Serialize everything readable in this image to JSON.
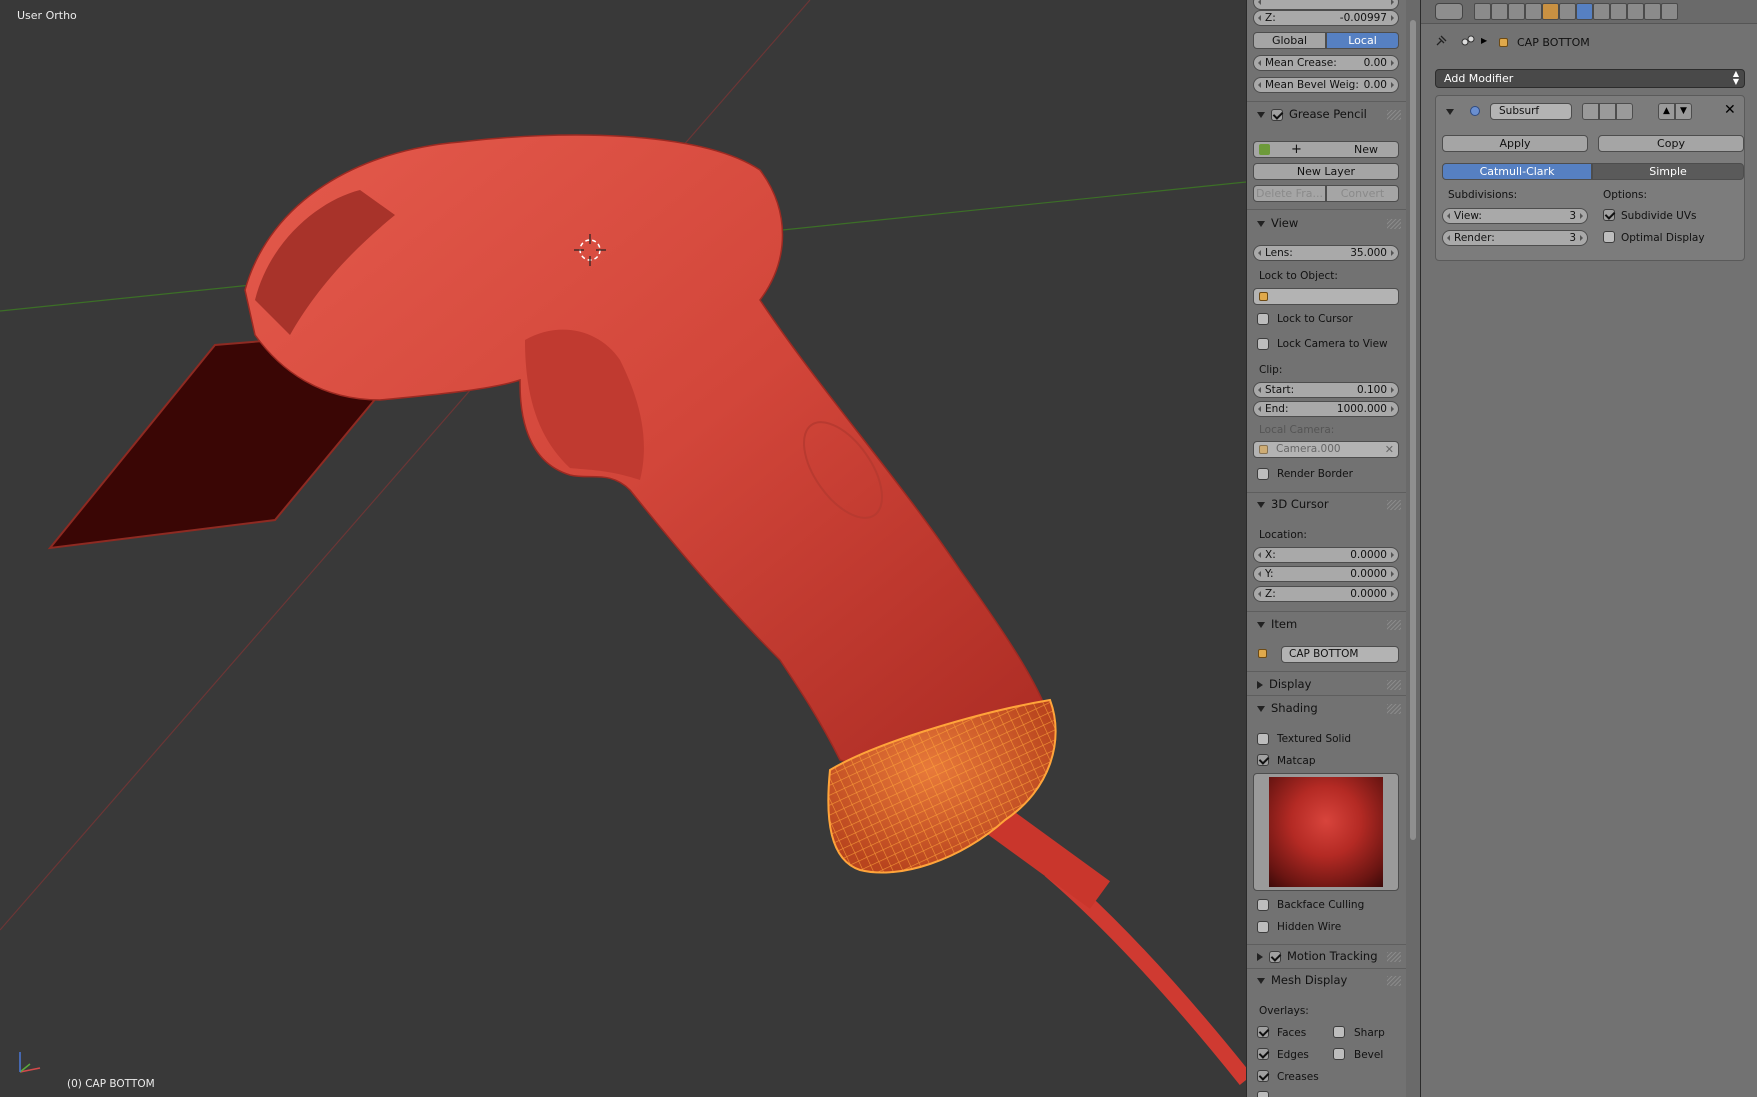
{
  "viewport": {
    "view_label": "User Ortho",
    "object_label": "(0) CAP BOTTOM",
    "colors": {
      "background": "#393939",
      "mesh": "#d8483e",
      "selection": "#ff9a2e",
      "x_axis": "#7a3a3a",
      "y_axis": "#3f7a28"
    }
  },
  "npanel": {
    "transform": {
      "z_label": "Z:",
      "z_value": "-0.00997",
      "global_label": "Global",
      "local_label": "Local",
      "mean_crease_label": "Mean Crease:",
      "mean_crease_value": "0.00",
      "mean_bevel_label": "Mean Bevel Weig:",
      "mean_bevel_value": "0.00"
    },
    "grease_pencil": {
      "title": "Grease Pencil",
      "new_label": "New",
      "new_layer_label": "New Layer",
      "delete_frame_label": "Delete Fra...",
      "convert_label": "Convert"
    },
    "view": {
      "title": "View",
      "lens_label": "Lens:",
      "lens_value": "35.000",
      "lock_to_object_label": "Lock to Object:",
      "lock_to_cursor_label": "Lock to Cursor",
      "lock_camera_label": "Lock Camera to View",
      "clip_label": "Clip:",
      "start_label": "Start:",
      "start_value": "0.100",
      "end_label": "End:",
      "end_value": "1000.000",
      "local_camera_label": "Local Camera:",
      "local_camera_value": "Camera.000",
      "render_border_label": "Render Border"
    },
    "cursor": {
      "title": "3D Cursor",
      "location_label": "Location:",
      "x_label": "X:",
      "x_value": "0.0000",
      "y_label": "Y:",
      "y_value": "0.0000",
      "z_label": "Z:",
      "z_value": "0.0000"
    },
    "item": {
      "title": "Item",
      "name": "CAP BOTTOM"
    },
    "display": {
      "title": "Display"
    },
    "shading": {
      "title": "Shading",
      "textured_solid_label": "Textured Solid",
      "matcap_label": "Matcap",
      "backface_label": "Backface Culling",
      "hidden_wire_label": "Hidden Wire"
    },
    "motion_tracking": {
      "title": "Motion Tracking"
    },
    "mesh_display": {
      "title": "Mesh Display",
      "overlays_label": "Overlays:",
      "faces_label": "Faces",
      "sharp_label": "Sharp",
      "edges_label": "Edges",
      "bevel_label": "Bevel",
      "creases_label": "Creases"
    }
  },
  "properties": {
    "object_name": "CAP BOTTOM",
    "add_modifier_label": "Add Modifier",
    "modifier": {
      "name": "Subsurf",
      "apply_label": "Apply",
      "copy_label": "Copy",
      "catmull_label": "Catmull-Clark",
      "simple_label": "Simple",
      "subdivisions_label": "Subdivisions:",
      "options_label": "Options:",
      "view_label": "View:",
      "view_value": "3",
      "render_label": "Render:",
      "render_value": "3",
      "subdivide_uvs_label": "Subdivide UVs",
      "optimal_display_label": "Optimal Display"
    }
  }
}
